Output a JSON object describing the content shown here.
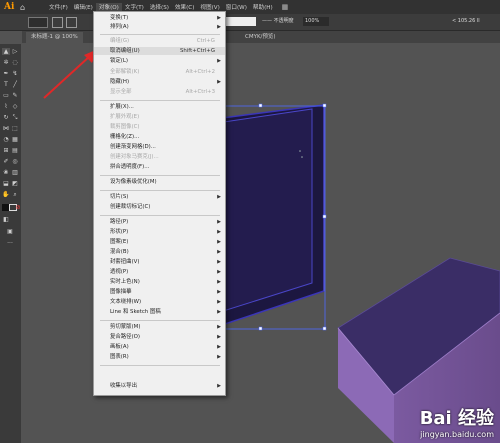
{
  "app": {
    "logo": "Ai",
    "home_icon": "home-icon"
  },
  "menubar": [
    {
      "label": "文件(F)"
    },
    {
      "label": "编辑(E)"
    },
    {
      "label": "对象(O)"
    },
    {
      "label": "文字(T)"
    },
    {
      "label": "选择(S)"
    },
    {
      "label": "效果(C)"
    },
    {
      "label": "视图(V)"
    },
    {
      "label": "窗口(W)"
    },
    {
      "label": "帮助(H)"
    }
  ],
  "control_bar": {
    "style_label": "—— 不透明度",
    "zoom": "100%",
    "coord": "< 105.26 ll"
  },
  "tabs": {
    "doc1": "未标题-1 @ 100%",
    "doc2": "CMYK/预览)"
  },
  "menu": {
    "items": [
      {
        "label": "变换(T)"
      },
      {
        "label": "排列(A)"
      },
      {
        "label": "编组(G)",
        "shortcut": "Ctrl+G"
      },
      {
        "label": "取消编组(U)",
        "shortcut": "Shift+Ctrl+G"
      },
      {
        "label": "锁定(L)"
      },
      {
        "label": "全部解锁(K)",
        "shortcut": "Alt+Ctrl+2"
      },
      {
        "label": "隐藏(H)"
      },
      {
        "label": "显示全部",
        "shortcut": "Alt+Ctrl+3"
      },
      {
        "label": "扩展(X)..."
      },
      {
        "label": "扩展外观(E)"
      },
      {
        "label": "裁剪图像(C)"
      },
      {
        "label": "栅格化(Z)..."
      },
      {
        "label": "创建渐变网格(D)..."
      },
      {
        "label": "创建对象马赛克(J)..."
      },
      {
        "label": "拼合透明度(F)..."
      },
      {
        "label": "设为像素级优化(M)"
      },
      {
        "label": "切片(S)"
      },
      {
        "label": "创建裁切标记(C)"
      },
      {
        "label": "路径(P)"
      },
      {
        "label": "形状(P)"
      },
      {
        "label": "图案(E)"
      },
      {
        "label": "混合(B)"
      },
      {
        "label": "封套扭曲(V)"
      },
      {
        "label": "透视(P)"
      },
      {
        "label": "实时上色(N)"
      },
      {
        "label": "图像描摹"
      },
      {
        "label": "文本绕排(W)"
      },
      {
        "label": "Line 和 Sketch 图稿"
      },
      {
        "label": "剪切蒙版(M)"
      },
      {
        "label": "复合路径(O)"
      },
      {
        "label": "画板(A)"
      },
      {
        "label": "图表(R)"
      },
      {
        "label": "收集以导出"
      }
    ]
  },
  "watermark": {
    "brand": "Bai 经验",
    "url": "jingyan.baidu.com"
  }
}
